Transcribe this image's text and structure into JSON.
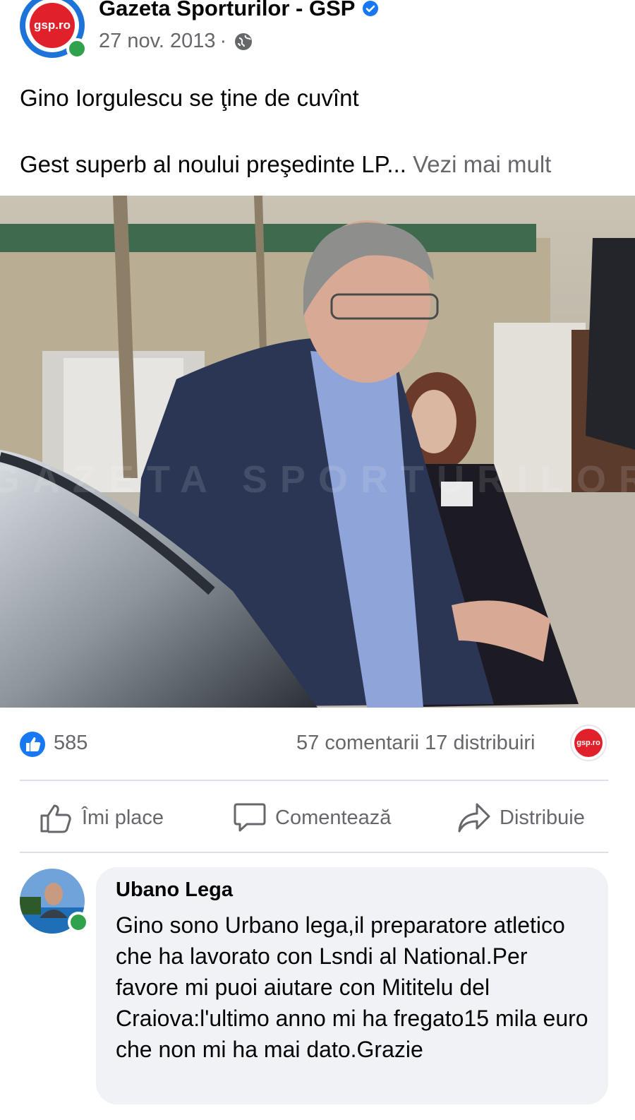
{
  "post": {
    "page_name": "Gazeta Sporturilor - GSP",
    "logo_text": "gsp.ro",
    "date": "27 nov. 2013",
    "separator": "·",
    "text_line1": "Gino Iorgulescu se ţine de cuvînt",
    "text_line2": "Gest superb al noului preşedinte LP...",
    "see_more": "Vezi mai mult",
    "photo_watermark": "GAZETA SPORTURILOR"
  },
  "reactions": {
    "like_count": "585",
    "comments_shares": "57 comentarii 17 distribuiri"
  },
  "actions": {
    "like": "Îmi place",
    "comment": "Comentează",
    "share": "Distribuie"
  },
  "comment": {
    "author": "Ubano Lega",
    "text": "Gino sono Urbano lega,il preparatore atletico che ha lavorato con Lsndi al National.Per favore mi puoi aiutare con Mititelu del Craiova:l'ultimo anno mi ha fregato15 mila euro che non mi ha mai dato.Grazie"
  },
  "colors": {
    "brand_blue": "#1877f2",
    "gsp_red": "#e0212b",
    "online_green": "#31a24c",
    "secondary_text": "#65676b"
  }
}
